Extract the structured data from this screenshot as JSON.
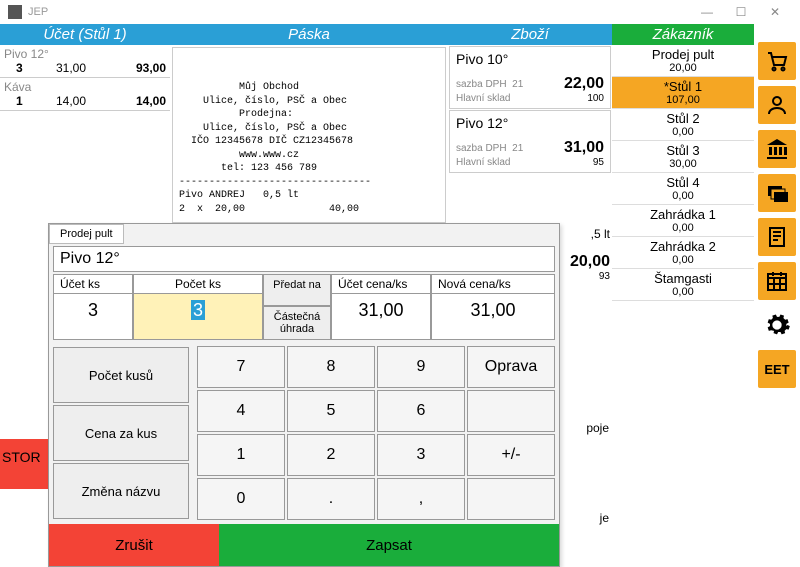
{
  "window": {
    "title": "JEP",
    "min": "—",
    "max": "☐",
    "close": "✕"
  },
  "headers": {
    "ucet": "Účet (Stůl 1)",
    "paska": "Páska",
    "zbozi": "Zboží",
    "zakaznik": "Zákazník"
  },
  "ucet_items": [
    {
      "name": "Pivo 12°",
      "qty": "3",
      "price": "31,00",
      "total": "93,00"
    },
    {
      "name": "Káva",
      "qty": "1",
      "price": "14,00",
      "total": "14,00"
    }
  ],
  "paska_text": "\n\n          Můj Obchod\n    Ulice, číslo, PSČ a Obec\n          Prodejna:\n    Ulice, číslo, PSČ a Obec\n  IČO 12345678 DIČ CZ12345678\n          www.www.cz\n       tel: 123 456 789\n--------------------------------\nPivo ANDREJ   0,5 lt\n2  x  20,00              40,00",
  "zbozi": [
    {
      "name": "Pivo 10°",
      "dph_lbl": "sazba DPH",
      "dph": "21",
      "price": "22,00",
      "sklad_lbl": "Hlavní sklad",
      "sklad": "100"
    },
    {
      "name": "Pivo 12°",
      "dph_lbl": "sazba DPH",
      "dph": "21",
      "price": "31,00",
      "sklad_lbl": "Hlavní sklad",
      "sklad": "95"
    }
  ],
  "zbozi_hidden": [
    {
      "lt": ",5 lt",
      "price": "20,00",
      "sklad": "93"
    }
  ],
  "peek": {
    "poje": "poje",
    "je": "je"
  },
  "zakaznik": [
    {
      "name": "Prodej pult",
      "val": "20,00",
      "active": false
    },
    {
      "name": "*Stůl 1",
      "val": "107,00",
      "active": true
    },
    {
      "name": "Stůl 2",
      "val": "0,00",
      "active": false
    },
    {
      "name": "Stůl 3",
      "val": "30,00",
      "active": false
    },
    {
      "name": "Stůl 4",
      "val": "0,00",
      "active": false
    },
    {
      "name": "Zahrádka 1",
      "val": "0,00",
      "active": false
    },
    {
      "name": "Zahrádka 2",
      "val": "0,00",
      "active": false
    },
    {
      "name": "Štamgasti",
      "val": "0,00",
      "active": false
    }
  ],
  "stor": "STOR",
  "dialog": {
    "tab": "Prodej pult",
    "input": "Pivo 12°",
    "cols": {
      "ucet": "Účet ks",
      "pocet": "Počet ks",
      "cena": "Účet cena/ks",
      "nova": "Nová cena/ks"
    },
    "vals": {
      "ucet": "3",
      "pocet": "3",
      "cena": "31,00",
      "nova": "31,00"
    },
    "smbtns": {
      "predat": "Předat na",
      "castecna": "Částečná úhrada"
    },
    "leftbtns": {
      "pocet": "Počet kusů",
      "cena": "Cena za kus",
      "zmena": "Změna názvu"
    },
    "keys": [
      "7",
      "8",
      "9",
      "Oprava",
      "4",
      "5",
      "6",
      "",
      "1",
      "2",
      "3",
      "+/-",
      "0",
      ".",
      ",",
      ""
    ],
    "cancel": "Zrušit",
    "save": "Zapsat"
  },
  "icons": [
    "cart",
    "person",
    "bank",
    "stack",
    "receipt",
    "grid",
    "gear",
    "eet"
  ],
  "eet_label": "EET"
}
